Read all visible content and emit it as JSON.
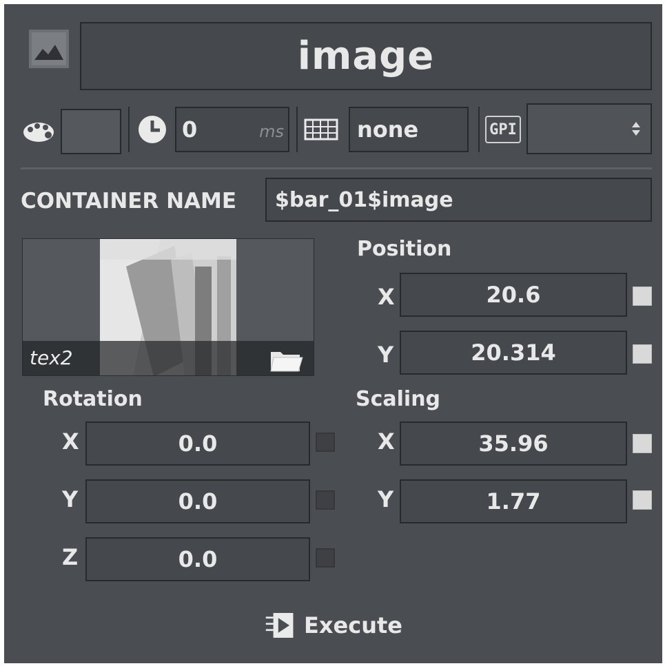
{
  "header": {
    "title": "image"
  },
  "toolbar": {
    "delay_value": "0",
    "delay_unit": "ms",
    "keyboard_value": "none",
    "gpi_label": "GPI",
    "gpi_value": ""
  },
  "container": {
    "label": "CONTAINER NAME",
    "value": "$bar_01$image"
  },
  "texture": {
    "name": "tex2"
  },
  "position": {
    "label": "Position",
    "x_label": "X",
    "x": "20.6",
    "y_label": "Y",
    "y": "20.314"
  },
  "rotation": {
    "label": "Rotation",
    "x_label": "X",
    "x": "0.0",
    "y_label": "Y",
    "y": "0.0",
    "z_label": "Z",
    "z": "0.0"
  },
  "scaling": {
    "label": "Scaling",
    "x_label": "X",
    "x": "35.96",
    "y_label": "Y",
    "y": "1.77"
  },
  "execute": {
    "label": "Execute"
  },
  "colors": {
    "panel_bg": "#4a4d51",
    "field_bg": "#45484c",
    "field_border": "#27292b",
    "text": "#e8e8e8"
  }
}
